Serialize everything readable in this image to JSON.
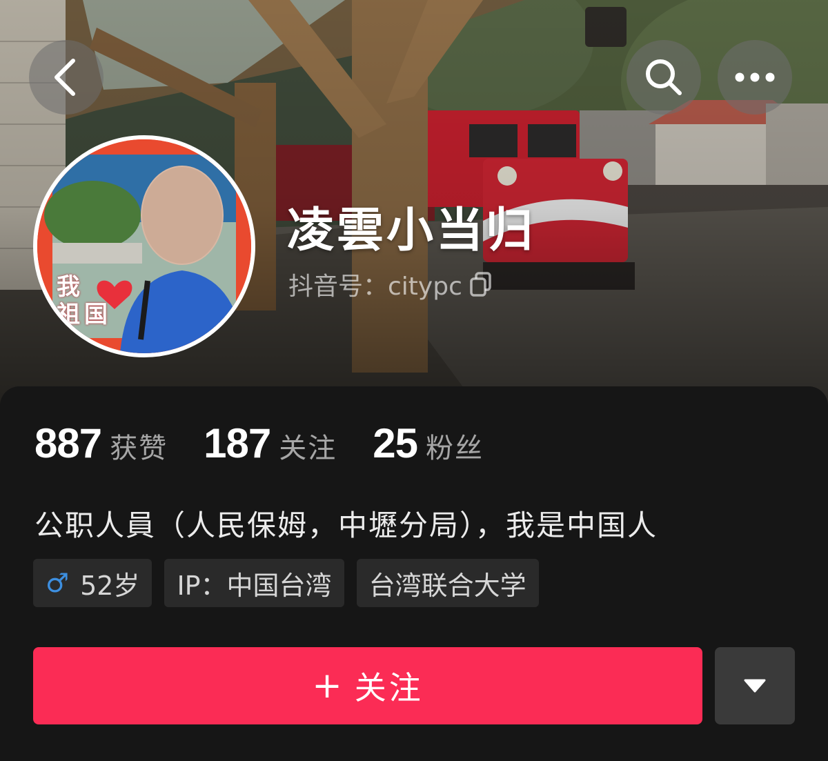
{
  "profile": {
    "nickname": "凌雲小当归",
    "douyin_id_label": "抖音号：citypc",
    "avatar_badge_line1": "我",
    "avatar_badge_line2": "祖国",
    "stats": [
      {
        "value": "887",
        "label": "获赞"
      },
      {
        "value": "187",
        "label": "关注"
      },
      {
        "value": "25",
        "label": "粉丝"
      }
    ],
    "bio": "公职人員（人民保姆，中壢分局），我是中国人",
    "tags": {
      "gender_symbol": "♂",
      "age": "52岁",
      "ip": "IP：中国台湾",
      "school": "台湾联合大学"
    }
  },
  "actions": {
    "follow_plus": "+",
    "follow_label": "关注"
  },
  "colors": {
    "accent": "#fb2c55",
    "male": "#3d8fe0",
    "panel": "#161616"
  },
  "icons": [
    "back-icon",
    "search-icon",
    "more-icon",
    "copy-icon",
    "chevron-down-icon"
  ]
}
